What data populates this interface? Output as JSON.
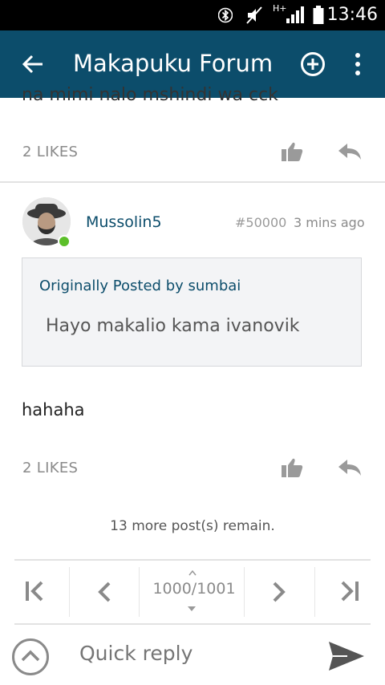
{
  "status_bar": {
    "time": "13:46",
    "network_label": "H+",
    "icons": [
      "bluetooth-icon",
      "mute-icon",
      "signal-icon",
      "battery-icon"
    ]
  },
  "app_bar": {
    "title": "Makapuku Forum",
    "icons": [
      "back-arrow-icon",
      "add-circle-icon",
      "more-vert-icon"
    ]
  },
  "previous_post": {
    "cut_text": "na mimi nalo mshindi wa cck",
    "likes": "2 LIKES"
  },
  "post": {
    "username": "Mussolin5",
    "post_number": "#50000",
    "time_ago": "3 mins ago",
    "online": true,
    "quote": {
      "header": "Originally Posted by sumbai",
      "text": "Hayo makalio kama ivanovik"
    },
    "message": "hahaha",
    "likes": "2 LIKES"
  },
  "remaining": "13 more post(s) remain.",
  "pagination": {
    "page_info": "1000/1001",
    "buttons": [
      "first-page",
      "prev-page",
      "next-page",
      "last-page"
    ]
  },
  "quick_reply": {
    "placeholder": "Quick reply"
  },
  "colors": {
    "app_bar": "#0c4d6b",
    "link": "#0c4d6b",
    "online": "#5cbf2a",
    "quote_bg": "#f3f4f6"
  }
}
